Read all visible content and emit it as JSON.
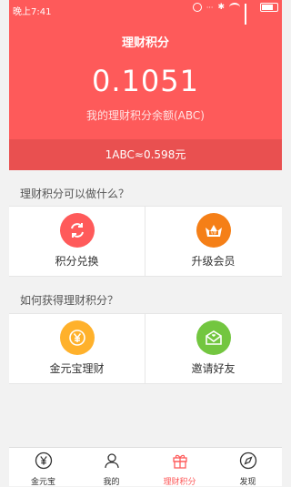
{
  "status": {
    "time": "晚上7:41"
  },
  "header": {
    "title": "理财积分",
    "balance": "0.1051",
    "balance_label": "我的理财积分余额(ABC)",
    "rate": "1ABC≈0.598元"
  },
  "section_use": {
    "title": "理财积分可以做什么？",
    "items": [
      {
        "label": "积分兑换",
        "icon": "exchange-icon",
        "color": "#ff5a5a"
      },
      {
        "label": "升级会员",
        "icon": "vip-crown-icon",
        "color": "#f57f17"
      }
    ]
  },
  "section_earn": {
    "title": "如何获得理财积分？",
    "items": [
      {
        "label": "金元宝理财",
        "icon": "yen-coin-icon",
        "color": "#ffb12b"
      },
      {
        "label": "邀请好友",
        "icon": "invite-envelope-icon",
        "color": "#73c640"
      }
    ]
  },
  "tabbar": {
    "tabs": [
      {
        "label": "金元宝",
        "icon": "yen-circle-icon"
      },
      {
        "label": "我的",
        "icon": "user-icon"
      },
      {
        "label": "理财积分",
        "icon": "gift-icon",
        "active": true
      },
      {
        "label": "发现",
        "icon": "compass-icon"
      }
    ]
  },
  "colors": {
    "brand": "#fe5a5a",
    "rate_bar": "#e95050"
  }
}
